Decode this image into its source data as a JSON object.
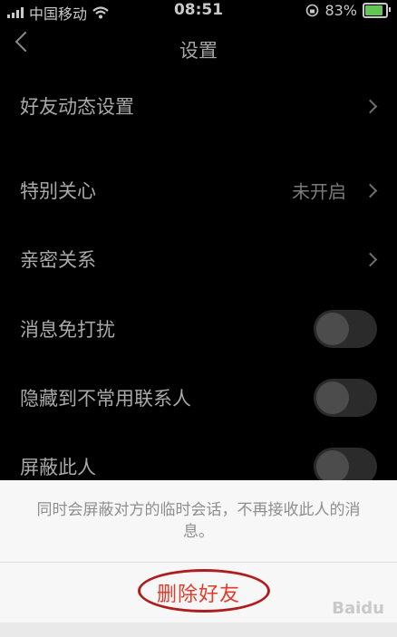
{
  "status_bar": {
    "carrier": "中国移动",
    "time": "08:51",
    "battery": "83%"
  },
  "nav": {
    "title": "设置"
  },
  "rows": [
    {
      "label": "好友动态设置",
      "value": ""
    },
    {
      "label": "特别关心",
      "value": "未开启"
    },
    {
      "label": "亲密关系",
      "value": ""
    },
    {
      "label": "消息免打扰",
      "value": ""
    },
    {
      "label": "隐藏到不常用联系人",
      "value": ""
    },
    {
      "label": "屏蔽此人",
      "value": ""
    }
  ],
  "toggles": {
    "do_not_disturb": false,
    "hide_contact": false,
    "block_person": false
  },
  "sheet": {
    "message": "同时会屏蔽对方的临时会话，不再接收此人的消息。",
    "delete_label": "删除好友"
  },
  "watermark": "Baidu",
  "colors": {
    "background": "#000000",
    "sheet": "#f7f7f7",
    "delete_text": "#e23b2a",
    "annotation_ring": "#b01d1d",
    "battery_fill": "#62c554"
  },
  "icons": [
    "signal-icon",
    "wifi-icon",
    "orientation-lock-icon",
    "battery-icon",
    "back-arrow-icon",
    "chevron-right-icon"
  ]
}
